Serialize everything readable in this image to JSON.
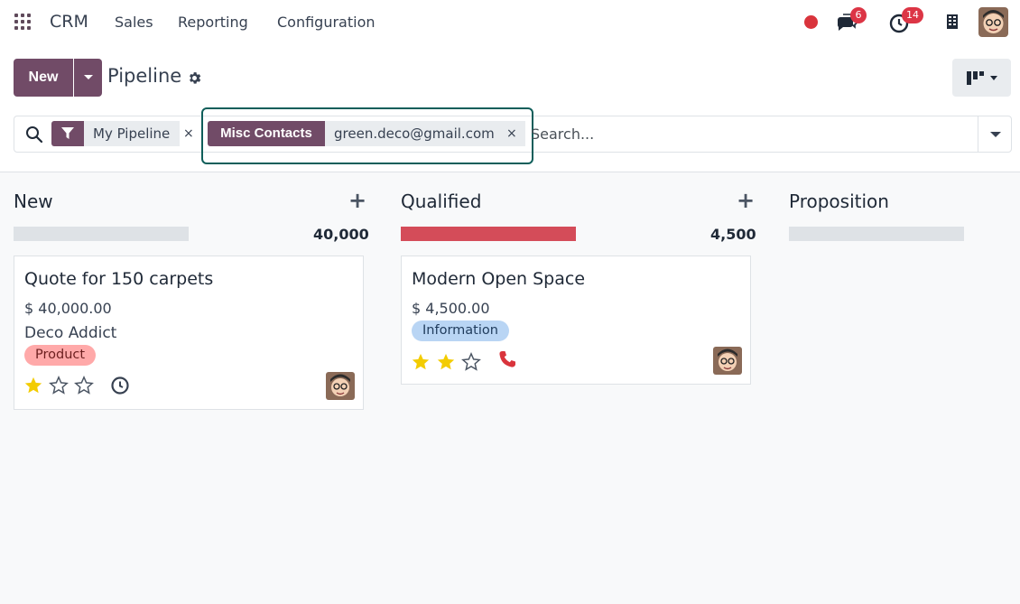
{
  "navbar": {
    "brand": "CRM",
    "menu": [
      "Sales",
      "Reporting",
      "Configuration"
    ],
    "chat_count": "6",
    "activity_count": "14"
  },
  "control": {
    "new_label": "New",
    "title": "Pipeline",
    "search": {
      "facet1": "My Pipeline",
      "facet2_label": "Misc Contacts",
      "facet2_value": "green.deco@gmail.com",
      "remove_glyph": "×",
      "placeholder": "Search..."
    }
  },
  "columns": [
    {
      "title": "New",
      "total": "40,000",
      "progress_fraction": 0
    },
    {
      "title": "Qualified",
      "total": "4,500",
      "progress_fraction": 1
    },
    {
      "title": "Proposition",
      "total": "",
      "progress_fraction": 0
    }
  ],
  "cards": [
    {
      "title": "Quote for 150 carpets",
      "amount": "$ 40,000.00",
      "customer": "Deco Addict",
      "tag": "Product",
      "rating": 1
    },
    {
      "title": "Modern Open Space",
      "amount": "$ 4,500.00",
      "tag": "Information",
      "rating": 2
    }
  ],
  "colors": {
    "brand": "#714b67",
    "danger": "#d44c59",
    "star": "#f3cc00",
    "tag_product": "#ffa9a9",
    "tag_information": "#b9d5f4"
  }
}
